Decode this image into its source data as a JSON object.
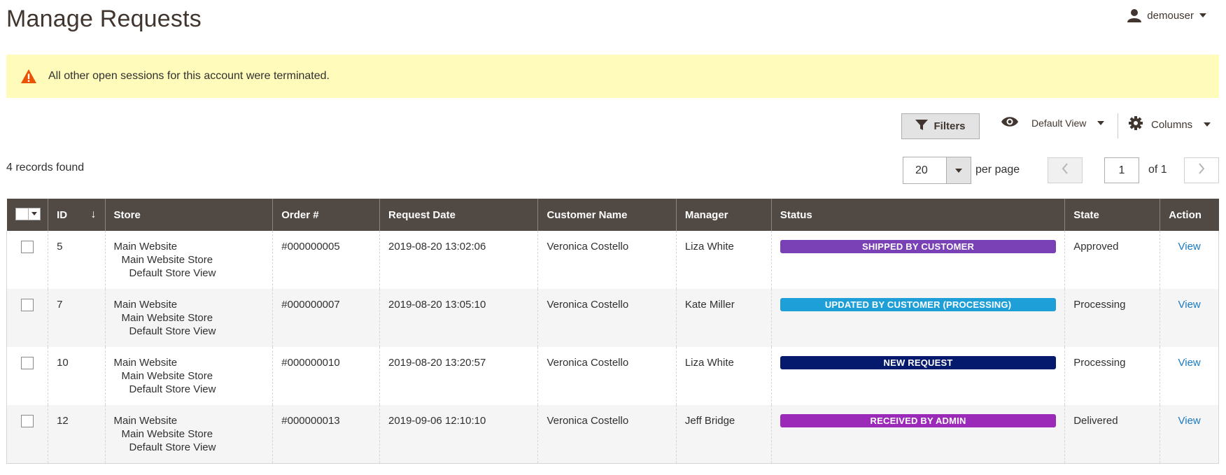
{
  "page": {
    "title": "Manage Requests"
  },
  "user": {
    "name": "demouser"
  },
  "message": {
    "text": "All other open sessions for this account were terminated."
  },
  "toolbar": {
    "filters_label": "Filters",
    "view_label": "Default View",
    "columns_label": "Columns"
  },
  "records": {
    "count_text": "4 records found"
  },
  "pager": {
    "per_page_value": "20",
    "per_page_label": "per page",
    "current_page": "1",
    "of_label": "of 1"
  },
  "grid": {
    "columns": {
      "id": "ID",
      "store": "Store",
      "order": "Order #",
      "request_date": "Request Date",
      "customer_name": "Customer Name",
      "manager": "Manager",
      "status": "Status",
      "state": "State",
      "action": "Action"
    },
    "rows": [
      {
        "id": "5",
        "store": [
          "Main Website",
          "Main Website Store",
          "Default Store View"
        ],
        "order": "#000000005",
        "request_date": "2019-08-20 13:02:06",
        "customer_name": "Veronica Costello",
        "manager": "Liza White",
        "status": "SHIPPED BY CUSTOMER",
        "status_color": "#7a40b6",
        "state": "Approved",
        "action": "View"
      },
      {
        "id": "7",
        "store": [
          "Main Website",
          "Main Website Store",
          "Default Store View"
        ],
        "order": "#000000007",
        "request_date": "2019-08-20 13:05:10",
        "customer_name": "Veronica Costello",
        "manager": "Kate Miller",
        "status": "UPDATED BY CUSTOMER (PROCESSING)",
        "status_color": "#1e9fd8",
        "state": "Processing",
        "action": "View"
      },
      {
        "id": "10",
        "store": [
          "Main Website",
          "Main Website Store",
          "Default Store View"
        ],
        "order": "#000000010",
        "request_date": "2019-08-20 13:20:57",
        "customer_name": "Veronica Costello",
        "manager": "Liza White",
        "status": "NEW REQUEST",
        "status_color": "#051a6d",
        "state": "Processing",
        "action": "View"
      },
      {
        "id": "12",
        "store": [
          "Main Website",
          "Main Website Store",
          "Default Store View"
        ],
        "order": "#000000013",
        "request_date": "2019-09-06 12:10:10",
        "customer_name": "Veronica Costello",
        "manager": "Jeff Bridge",
        "status": "RECEIVED BY ADMIN",
        "status_color": "#9b2ab8",
        "state": "Delivered",
        "action": "View"
      }
    ]
  },
  "colors": {
    "header_bg": "#514943",
    "message_bg": "#fffbbb",
    "warning_icon": "#eb5202",
    "link": "#1979c3"
  },
  "icons": {
    "user": "user-icon",
    "warning": "warning-icon",
    "filter": "filter-icon",
    "eye": "eye-icon",
    "gear": "gear-icon",
    "sort": "sort-arrow-icon"
  }
}
